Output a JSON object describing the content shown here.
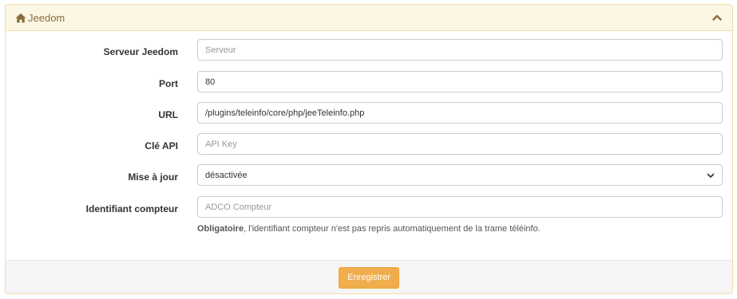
{
  "panel": {
    "title": "Jeedom",
    "icon": "home-icon",
    "collapse_icon": "chevron-up-icon"
  },
  "form": {
    "server": {
      "label": "Serveur Jeedom",
      "value": "",
      "placeholder": "Serveur"
    },
    "port": {
      "label": "Port",
      "value": "80",
      "placeholder": ""
    },
    "url": {
      "label": "URL",
      "value": "/plugins/teleinfo/core/php/jeeTeleinfo.php",
      "placeholder": ""
    },
    "api_key": {
      "label": "Clé API",
      "value": "",
      "placeholder": "API Key"
    },
    "update": {
      "label": "Mise à jour",
      "selected": "désactivée"
    },
    "meter_id": {
      "label": "Identifiant compteur",
      "value": "",
      "placeholder": "ADCO Compteur",
      "help_bold": "Obligatoire",
      "help_text": ", l'identifiant compteur n'est pas repris automatiquement de la trame téléinfo."
    }
  },
  "footer": {
    "save_label": "Enregistrer"
  },
  "colors": {
    "heading_bg": "#fcf7e4",
    "heading_border": "#f3dca7",
    "heading_text": "#8a6d3b",
    "save_button": "#f0ad4e"
  }
}
